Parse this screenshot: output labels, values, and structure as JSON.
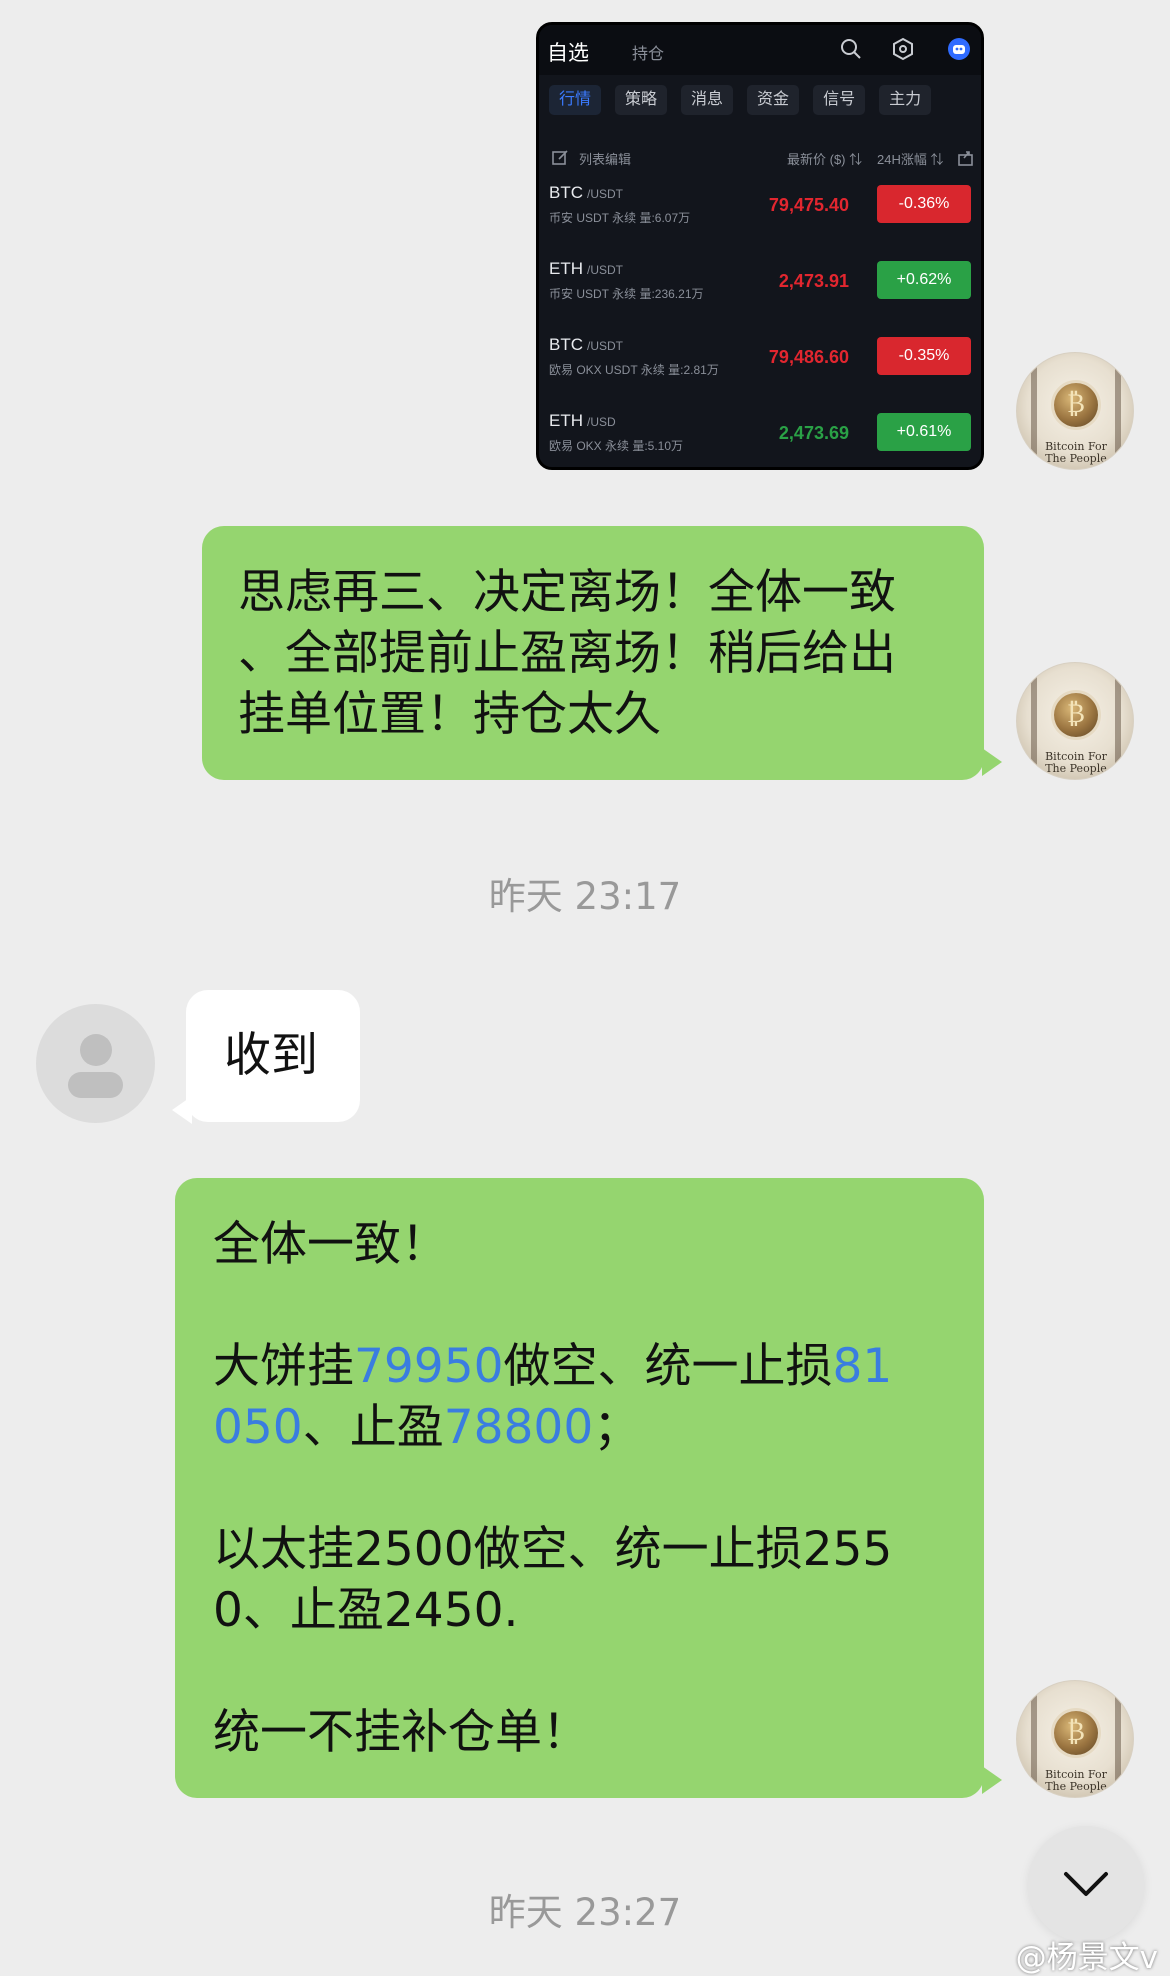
{
  "screenshot": {
    "title": "自选",
    "subtitle": "持仓",
    "tabs": [
      "行情",
      "策略",
      "消息",
      "资金",
      "信号",
      "主力"
    ],
    "list_header": {
      "edit": "列表编辑",
      "price": "最新价 ($) ⇅",
      "change": "24H涨幅 ⇅"
    },
    "rows": [
      {
        "symbol": "BTC",
        "pair": "/USDT",
        "sub": "币安 USDT 永续 量:6.07万",
        "price": "79,475.40",
        "change": "-0.36%",
        "dir": "down"
      },
      {
        "symbol": "ETH",
        "pair": "/USDT",
        "sub": "币安 USDT 永续 量:236.21万",
        "price": "2,473.91",
        "change": "+0.62%",
        "dir": "up"
      },
      {
        "symbol": "BTC",
        "pair": "/USDT",
        "sub": "欧易 OKX USDT 永续 量:2.81万",
        "price": "79,486.60",
        "change": "-0.35%",
        "dir": "down"
      },
      {
        "symbol": "ETH",
        "pair": "/USD",
        "sub": "欧易 OKX 永续 量:5.10万",
        "price": "2,473.69",
        "change": "+0.61%",
        "dir": "up"
      }
    ],
    "colors": {
      "up": "#2aa146",
      "down": "#d9272e",
      "up_text": "#2aa146",
      "down_text": "#e2262f"
    }
  },
  "avatar": {
    "caption_line1": "Bitcoin For",
    "caption_line2": "The People"
  },
  "messages": {
    "m1": {
      "line1": "思虑再三、决定离场！全体一致",
      "line2": "、全部提前止盈离场！稍后给出",
      "line3": "挂单位置！持仓太久"
    },
    "time1": "昨天 23:17",
    "m2": {
      "text": "收到"
    },
    "m3": {
      "l1": "全体一致！",
      "l2a": "大饼挂",
      "l2n1": "79950",
      "l2b": "做空、统一止损",
      "l2n2": "81",
      "l3n2": "050",
      "l3a": "、止盈",
      "l3n3": "78800",
      "l3b": "；",
      "l4": "以太挂2500做空、统一止损255",
      "l5": "0、止盈2450.",
      "l6": "统一不挂补仓单！"
    },
    "time2": "昨天 23:27"
  },
  "watermark": "@杨景文v"
}
